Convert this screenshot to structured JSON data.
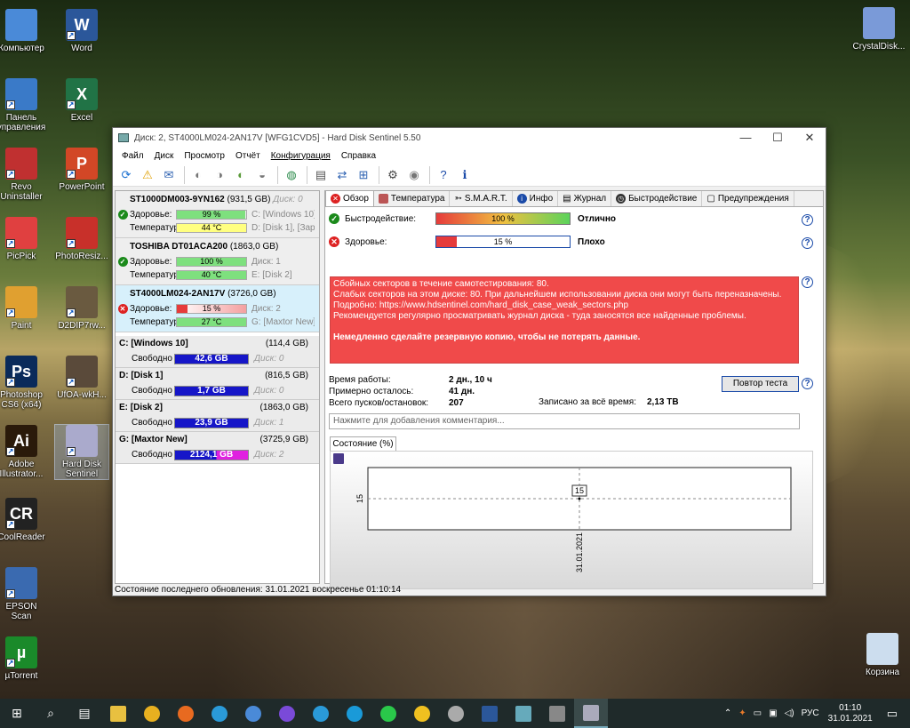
{
  "desktop": {
    "icons_left": [
      {
        "label": "Компьютер",
        "icon": "computer-icon"
      },
      {
        "label": "Word",
        "icon": "word-icon"
      },
      {
        "label": "Панель управления",
        "icon": "control-panel-icon"
      },
      {
        "label": "Excel",
        "icon": "excel-icon"
      },
      {
        "label": "Revo Uninstaller",
        "icon": "revo-icon"
      },
      {
        "label": "PowerPoint",
        "icon": "powerpoint-icon"
      },
      {
        "label": "PicPick",
        "icon": "picpick-icon"
      },
      {
        "label": "PhotoResiz...",
        "icon": "photoresizer-icon"
      },
      {
        "label": "Paint",
        "icon": "paint-icon"
      },
      {
        "label": "D2DIP7rw...",
        "icon": "d2dip-icon"
      },
      {
        "label": "Photoshop CS6 (x64)",
        "icon": "photoshop-icon"
      },
      {
        "label": "UfOA-wkH...",
        "icon": "image-file-icon"
      },
      {
        "label": "Adobe Illustrator...",
        "icon": "illustrator-icon"
      },
      {
        "label": "Hard Disk Sentinel",
        "icon": "hdsentinel-icon"
      },
      {
        "label": "CoolReader",
        "icon": "coolreader-icon"
      },
      {
        "label": "EPSON Scan",
        "icon": "epson-scan-icon"
      },
      {
        "label": "µTorrent",
        "icon": "utorrent-icon"
      }
    ],
    "icons_right": [
      {
        "label": "CrystalDisk...",
        "icon": "crystaldisk-icon"
      },
      {
        "label": "Корзина",
        "icon": "recycle-bin-icon"
      }
    ]
  },
  "window": {
    "title": "Диск: 2, ST4000LM024-2AN17V [WFG1CVD5]  -  Hard Disk Sentinel 5.50",
    "menu": [
      "Файл",
      "Диск",
      "Просмотр",
      "Отчёт",
      "Конфигурация",
      "Справка"
    ],
    "disks": [
      {
        "name": "ST1000DM003-9YN162",
        "size": "(931,5 GB)",
        "disk": "Диск: 0",
        "health_label": "Здоровье:",
        "health": "99 %",
        "health_pct": 99,
        "health_color": "#7ee07e",
        "health_right": "C: [Windows 10], ",
        "temp_label": "Температура:",
        "temp": "44 °C",
        "temp_color": "#ffff80",
        "temp_right": "D: [Disk 1],  [Заре",
        "status": "ok"
      },
      {
        "name": "TOSHIBA DT01ACA200",
        "size": "(1863,0 GB)",
        "disk": "",
        "health_label": "Здоровье:",
        "health": "100 %",
        "health_pct": 100,
        "health_color": "#7ee07e",
        "health_right": "Диск: 1",
        "temp_label": "Температура:",
        "temp": "40 °C",
        "temp_color": "#7ee07e",
        "temp_right": "E: [Disk 2]",
        "status": "ok"
      },
      {
        "name": "ST4000LM024-2AN17V",
        "size": "(3726,0 GB)",
        "disk": "",
        "health_label": "Здоровье:",
        "health": "15 %",
        "health_pct": 15,
        "health_color": "#f27c7c",
        "health_right": "Диск: 2",
        "temp_label": "Температура:",
        "temp": "27 °C",
        "temp_color": "#7ee07e",
        "temp_right": "G: [Maxtor New]",
        "status": "bad"
      }
    ],
    "partitions": [
      {
        "name": "C: [Windows 10]",
        "size": "(114,4 GB)",
        "free_label": "Свободно",
        "free": "42,6 GB",
        "free_pct": 37,
        "free_color": "#1616c8",
        "disk": "Диск: 0"
      },
      {
        "name": "D: [Disk 1]",
        "size": "(816,5 GB)",
        "free_label": "Свободно",
        "free": "1,7 GB",
        "free_pct": 100,
        "free_color": "#1616c8",
        "disk": "Диск: 0"
      },
      {
        "name": "E: [Disk 2]",
        "size": "(1863,0 GB)",
        "free_label": "Свободно",
        "free": "23,9 GB",
        "free_pct": 100,
        "free_color": "#1616c8",
        "disk": "Диск: 1"
      },
      {
        "name": "G: [Maxtor New]",
        "size": "(3725,9 GB)",
        "free_label": "Свободно",
        "free": "2124,1 GB",
        "free_pct": 57,
        "free_color": "#1616c8",
        "disk": "Диск: 2"
      }
    ],
    "tabs": [
      "Обзор",
      "Температура",
      "S.M.A.R.T.",
      "Инфо",
      "Журнал",
      "Быстродействие",
      "Предупреждения"
    ],
    "overview": {
      "perf_label": "Быстродействие:",
      "perf_value": "100 %",
      "perf_pct": 100,
      "perf_status": "Отлично",
      "health_label": "Здоровье:",
      "health_value": "15 %",
      "health_pct": 15,
      "health_status": "Плохо",
      "alert_lines": [
        "Сбойных секторов в течение самотестирования: 80.",
        "Слабых секторов на этом диске: 80. При дальнейшем использовании диска они могут быть переназначены.",
        "Подробно: https://www.hdsentinel.com/hard_disk_case_weak_sectors.php",
        "Рекомендуется регулярно просматривать журнал диска - туда заносятся все найденные проблемы."
      ],
      "alert_bold": "Немедленно сделайте резервную копию, чтобы не потерять данные.",
      "uptime_label": "Время работы:",
      "uptime": "2 дн., 10 ч",
      "remain_label": "Примерно осталось:",
      "remain": "41 дн.",
      "starts_label": "Всего пусков/остановок:",
      "starts": "207",
      "written_label": "Записано за всё время:",
      "written": "2,13 TB",
      "retest_button": "Повтор теста",
      "comment_placeholder": "Нажмите для добавления комментария...",
      "chart_tab": "Состояние (%)"
    },
    "status_bar": "Состояние последнего обновления: 31.01.2021 воскресенье 01:10:14"
  },
  "chart_data": {
    "type": "line",
    "x": [
      "31.01.2021"
    ],
    "series": [
      {
        "values": [
          15
        ]
      }
    ],
    "y_tick_labels": [
      "15"
    ],
    "data_labels": [
      "15"
    ],
    "grid": true
  },
  "taskbar": {
    "apps": [
      "start-icon",
      "search-icon",
      "task-view-icon",
      "explorer-icon",
      "chrome-icon",
      "firefox-icon",
      "edge-icon",
      "store-icon",
      "viber-icon",
      "telegram-icon",
      "skype-icon",
      "whatsapp-icon",
      "norton-icon",
      "hdsentinel-icon",
      "word-icon",
      "notepad-icon",
      "calculator-icon",
      "hdsentinel-active-icon"
    ],
    "lang": "РУС",
    "time": "01:10",
    "date": "31.01.2021"
  }
}
